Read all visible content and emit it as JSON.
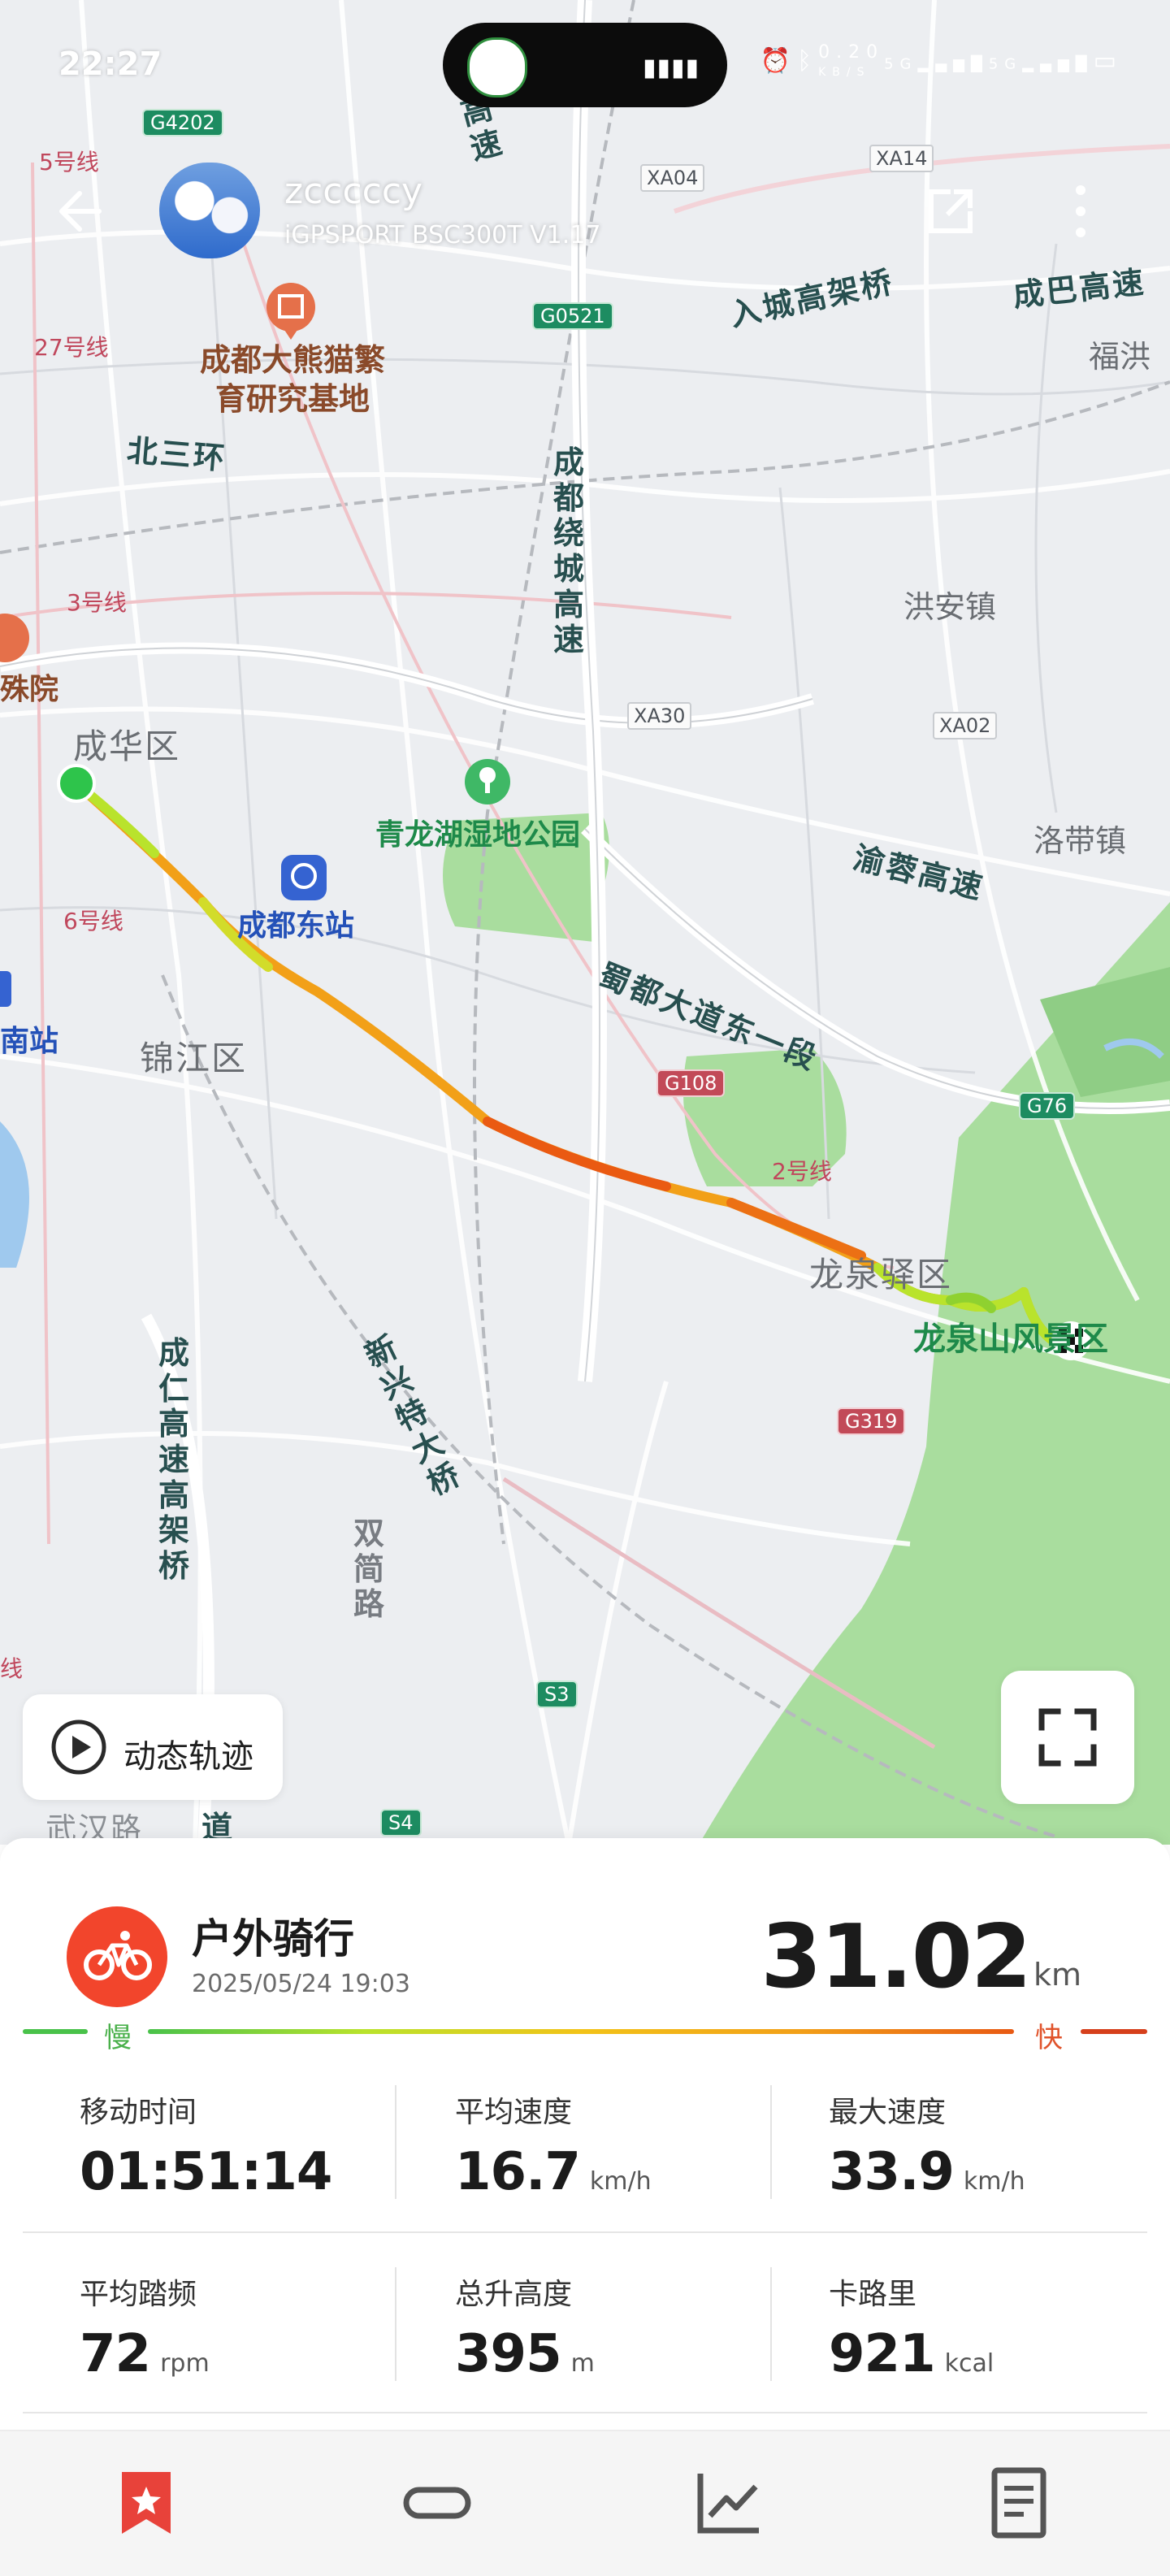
{
  "status_bar": {
    "time": "22:27",
    "net_speed_value": "0.20",
    "net_speed_unit": "KB/S",
    "signal_1": "5G",
    "signal_2": "5G"
  },
  "header": {
    "username": "zcccccy",
    "device": "iGPSPORT BSC300T  V1.17"
  },
  "map": {
    "district_labels": [
      "成华区",
      "锦江区",
      "龙泉驿区"
    ],
    "town_labels": [
      "洪安镇",
      "洛带镇",
      "福洪"
    ],
    "road_labels": [
      "入城高架桥",
      "成巴高速",
      "北三环",
      "渝蓉高速",
      "蜀都大道东一段"
    ],
    "vertical_roads": [
      "成都绕城高速",
      "成仁高速高架桥",
      "新兴特大桥",
      "高速"
    ],
    "gray_vertical": "双简路",
    "poi_panda": "成都大熊猫繁育研究基地",
    "poi_lake": "青龙湖湿地公园",
    "poi_station": "成都东站",
    "poi_scenic": "龙泉山风景区",
    "poi_hospital_partial": "殊院",
    "station_partial": "南站",
    "metro_lines": [
      "5号线",
      "27号线",
      "3号线",
      "6号线",
      "2号线",
      "线"
    ],
    "partial_bottom": [
      "武汉路",
      "道"
    ],
    "shields_green": [
      "G4202",
      "G0521",
      "G76",
      "S3",
      "S4"
    ],
    "shields_red": [
      "G108",
      "G319"
    ],
    "shields_x": [
      "XA04",
      "XA14",
      "XA30",
      "XA02"
    ],
    "colors": {
      "start": "#2ec44b",
      "park": "#a9dd9e",
      "route_mid": "#f2a018",
      "route_fast": "#ea5a12",
      "route_slow": "#b9e32c"
    }
  },
  "controls": {
    "replay_label": "动态轨迹"
  },
  "activity": {
    "sport_name": "户外骑行",
    "date": "2025/05/24 19:03",
    "distance": "31.02",
    "distance_unit": "km",
    "scale_slow": "慢",
    "scale_fast": "快",
    "accent_color": "#f2452c"
  },
  "stats": [
    {
      "label": "移动时间",
      "value": "01:51:14",
      "unit": ""
    },
    {
      "label": "平均速度",
      "value": "16.7",
      "unit": "km/h"
    },
    {
      "label": "最大速度",
      "value": "33.9",
      "unit": "km/h"
    },
    {
      "label": "平均踏频",
      "value": "72",
      "unit": "rpm"
    },
    {
      "label": "总升高度",
      "value": "395",
      "unit": "m"
    },
    {
      "label": "卡路里",
      "value": "921",
      "unit": "kcal"
    }
  ],
  "nav": {
    "items": [
      "bookmark-icon",
      "loop-icon",
      "chart-icon",
      "document-icon"
    ],
    "active_color": "#e8423a"
  }
}
